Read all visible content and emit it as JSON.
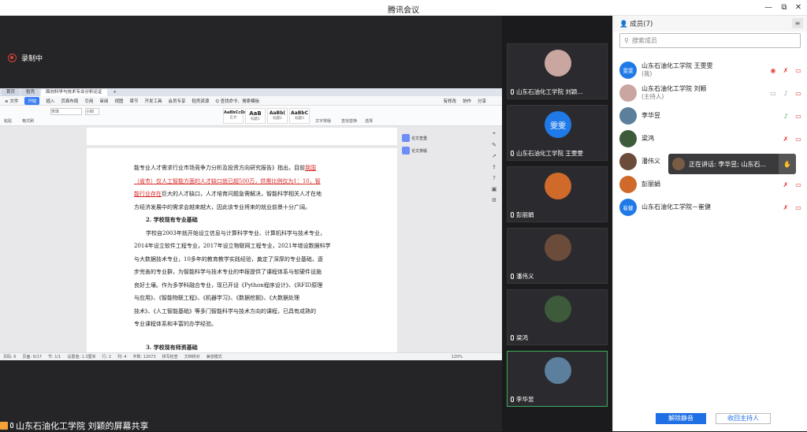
{
  "window": {
    "title": "腾讯会议",
    "controls": [
      "—",
      "⧉",
      "✕"
    ]
  },
  "recording": {
    "label": "录制中"
  },
  "share": {
    "presenter": "山东石油化工学院 刘颖的屏幕共享",
    "tabs": [
      "首页",
      "稻壳",
      "面向科学与技术专业分析论证",
      "+"
    ],
    "menu": [
      "≡ 文件",
      "开始",
      "插入",
      "页面布局",
      "引用",
      "审阅",
      "视图",
      "章节",
      "开发工具",
      "会员专享",
      "稻壳资源",
      "Q 查找命令、搜索模板"
    ],
    "menu_right": [
      "有修改",
      "协作",
      "分享"
    ],
    "ribbon_labels": [
      "粘贴",
      "格式刷",
      "宋体",
      "小四",
      "正文",
      "标题1",
      "标题2",
      "标题3",
      "文字排版",
      "查找替换",
      "选择"
    ],
    "styles": [
      {
        "big": "AaBbCcDc",
        "sm": "正文"
      },
      {
        "big": "AaB",
        "sm": "标题1"
      },
      {
        "big": "AaBb(",
        "sm": "标题2"
      },
      {
        "big": "AaBbC",
        "sm": "标题3"
      }
    ],
    "side_panel": [
      "论文查重",
      "论文排版"
    ],
    "doc_lines": [
      {
        "text": "能专业人才需求行业市场竞争力分析及投资方向研究报告》指出，目前",
        "red": "我国"
      },
      {
        "text": "",
        "red": "（省市）仅人工智能方面的人才缺口就已超500万，供需比例仅为1：10，智"
      },
      {
        "text": "",
        "red": "能行业存在",
        "after": "巨大的人才缺口，人才培育问题急需解决，智能科学相关人才在地"
      },
      {
        "text": "方经济发展中的需求会越来越大，因此该专业将来的就业前景十分广阔。"
      },
      {
        "text": "2. 学校现有专业基础",
        "bold": true
      },
      {
        "text": "学校自2003年就开始设立信息与计算科学专业、计算机科学与技术专业，"
      },
      {
        "text": "2014年设立软件工程专业，2017年设立物联网工程专业，2021年增设数据科学"
      },
      {
        "text": "与大数据技术专业，10多年的教育教学实践经验，奠定了深厚的专业基础，逐"
      },
      {
        "text": "步完善的专业群，为智能科学与技术专业的申报提供了课程体系与软硬件设施"
      },
      {
        "text": "良好土壤。作为多学科融合专业，现已开设《Python程序设计》、《RFID原理"
      },
      {
        "text": "与应用》、《智能物联工程》、《机器学习》、《数据挖掘》、《大数据处理"
      },
      {
        "text": "技术》、《人工智能基础》等多门智能科学与技术方向的课程，已具有成熟的"
      },
      {
        "text": "专业课程体系和丰富的办学经验。"
      },
      {
        "text": "3. 学校现有师资基础",
        "bold": true
      }
    ],
    "status": [
      "页码: 6",
      "页面: 6/17",
      "节: 1/1",
      "设置值: 1.3厘米",
      "行: 2",
      "列: 4",
      "字数: 12073",
      "拼写检查",
      "文档校对",
      "兼容模式",
      "120%"
    ]
  },
  "video_tiles": [
    {
      "name": "山东石油化工学院 刘颖...",
      "avatar_color": "#c9a7a0",
      "icons": true
    },
    {
      "name": "山东石油化工学院 王雯雯",
      "avatar_text": "雯雯",
      "avatar_color": "#1f7ae8"
    },
    {
      "name": "彭丽娟",
      "avatar_color": "#d06a2a"
    },
    {
      "name": "潘伟义",
      "avatar_color": "#6b4c3b"
    },
    {
      "name": "梁鸿",
      "avatar_color": "#3d5a3a"
    },
    {
      "name": "李华昱",
      "avatar_color": "#5b7f9c",
      "active": true
    }
  ],
  "members": {
    "title": "成员(7)",
    "search_placeholder": "搜索成员",
    "list": [
      {
        "name": "山东石油化工学院 王雯雯",
        "sub": "(我)",
        "avatar_text": "雯雯",
        "color": "#1f7ae8",
        "rec": true
      },
      {
        "name": "山东石油化工学院 刘颖",
        "sub": "(主持人)",
        "color": "#c9a7a0",
        "screen": true
      },
      {
        "name": "李华昱",
        "color": "#5b7f9c",
        "mic_green": true
      },
      {
        "name": "梁鸿",
        "color": "#3d5a3a"
      },
      {
        "name": "潘伟义",
        "color": "#6b4c3b"
      },
      {
        "name": "彭丽娟",
        "color": "#d06a2a"
      },
      {
        "name": "山东石油化工学院－崔健",
        "avatar_text": "崔健",
        "color": "#1f7ae8"
      }
    ],
    "tooltip": "正在讲话: 李华昱; 山东石...",
    "unmute_all": "解除静音",
    "reclaim_host": "收回主持人"
  }
}
